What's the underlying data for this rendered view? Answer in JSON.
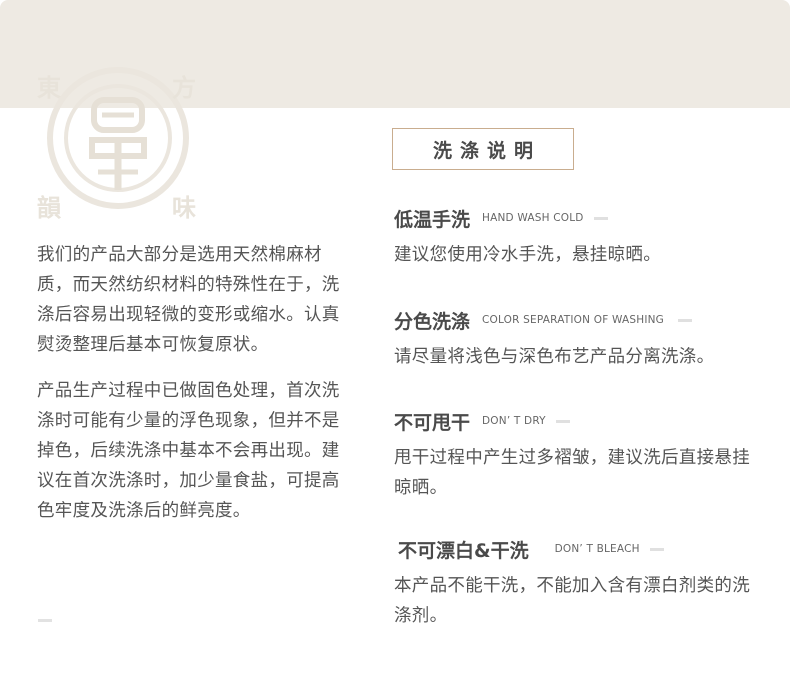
{
  "header": {
    "logo": {
      "corners": [
        "東",
        "方",
        "韻",
        "味"
      ]
    }
  },
  "intro": {
    "paragraphs": [
      "我们的产品大部分是选用天然棉麻材质，而天然纺织材料的特殊性在于，洗涤后容易出现轻微的变形或缩水。认真熨烫整理后基本可恢复原状。",
      "产品生产过程中已做固色处理，首次洗涤时可能有少量的浮色现象，但并不是掉色，后续洗涤中基本不会再出现。建议在首次洗涤时，加少量食盐，可提高色牢度及洗涤后的鲜亮度。"
    ]
  },
  "care": {
    "title": "洗涤说明",
    "items": [
      {
        "title": "低温手洗",
        "subtitle": "HAND WASH COLD",
        "text": "建议您使用冷水手洗，悬挂晾晒。"
      },
      {
        "title": "分色洗涤",
        "subtitle": "COLOR SEPARATION OF WASHING",
        "text": "请尽量将浅色与深色布艺产品分离洗涤。"
      },
      {
        "title": "不可甩干",
        "subtitle": "DON’ T DRY",
        "text": "甩干过程中产生过多褶皱，建议洗后直接悬挂晾晒。"
      },
      {
        "title": "不可漂白&干洗",
        "subtitle": "DON’ T BLEACH",
        "text": "本产品不能干洗，不能加入含有漂白剂类的洗涤剂。"
      }
    ]
  },
  "colors": {
    "band": "#eeeae3",
    "accent_border": "#c9ad8f",
    "heading": "#4a4a4a",
    "body_text": "#555555"
  }
}
